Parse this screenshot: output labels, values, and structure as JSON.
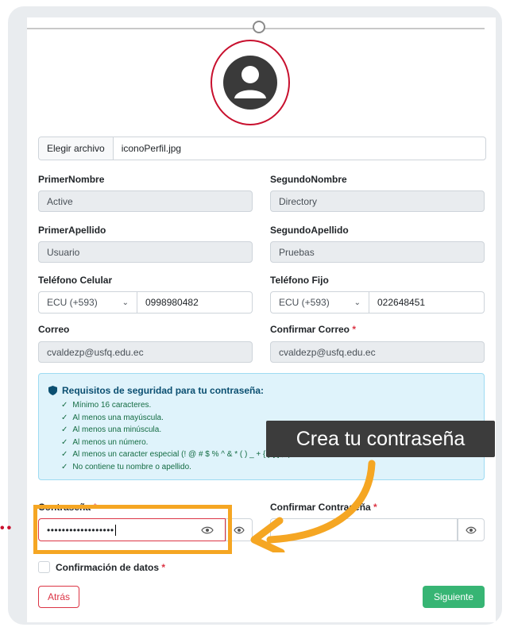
{
  "file": {
    "button": "Elegir archivo",
    "filename": "iconoPerfil.jpg"
  },
  "fields": {
    "primer_nombre": {
      "label": "PrimerNombre",
      "value": "Active"
    },
    "segundo_nombre": {
      "label": "SegundoNombre",
      "value": "Directory"
    },
    "primer_apellido": {
      "label": "PrimerApellido",
      "value": "Usuario"
    },
    "segundo_apellido": {
      "label": "SegundoApellido",
      "value": "Pruebas"
    },
    "telefono_celular": {
      "label": "Teléfono Celular",
      "code": "ECU (+593)",
      "value": "0998980482"
    },
    "telefono_fijo": {
      "label": "Teléfono Fijo",
      "code": "ECU (+593)",
      "value": "022648451"
    },
    "correo": {
      "label": "Correo",
      "value": "cvaldezp@usfq.edu.ec"
    },
    "confirmar_correo": {
      "label": "Confirmar Correo",
      "required": "*",
      "value": "cvaldezp@usfq.edu.ec"
    }
  },
  "requirements": {
    "title": "Requisitos de seguridad para tu contraseña:",
    "items": [
      "Mínimo 16 caracteres.",
      "Al menos una mayúscula.",
      "Al menos una minúscula.",
      "Al menos un número.",
      "Al menos un caracter especial (! @ # $ % ^ & * ( ) _ + { } [ ] ; :)",
      "No contiene tu nombre o apellido."
    ]
  },
  "tooltip": "Crea tu contraseña",
  "password": {
    "label": "Contraseña",
    "required": "*",
    "value": "••••••••••••••••••",
    "confirm_label": "Confirmar Contraseña",
    "confirm_required": "*"
  },
  "confirmacion": {
    "label": "Confirmación de datos",
    "required": "*"
  },
  "buttons": {
    "back": "Atrás",
    "next": "Siguiente"
  },
  "colors": {
    "accent_red": "#dc3545",
    "success_green": "#37b574",
    "highlight_orange": "#f5a623",
    "info_bg": "#dff3fb",
    "tooltip_bg": "#3c3c3c"
  }
}
